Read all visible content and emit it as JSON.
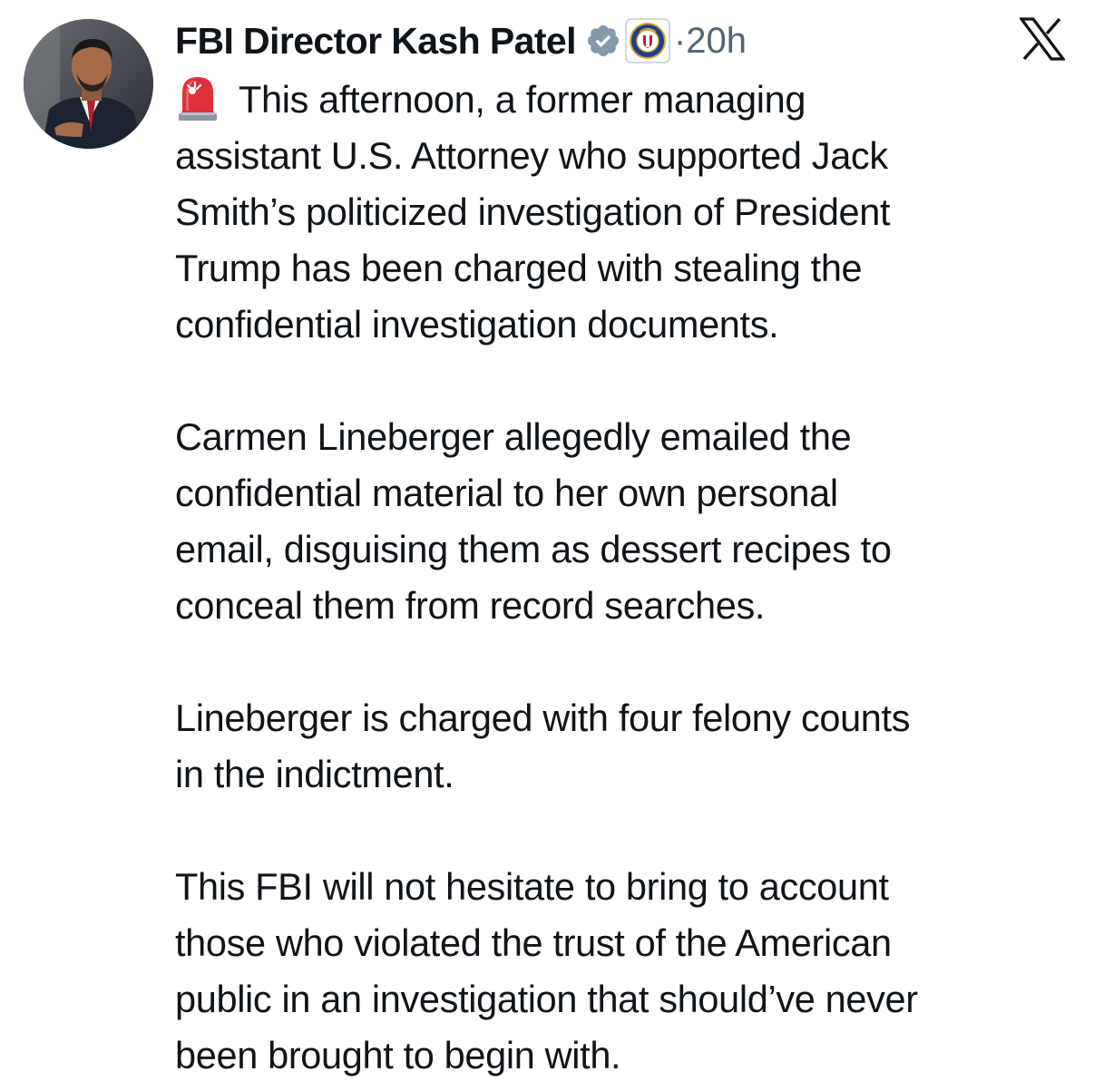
{
  "tweet": {
    "author": {
      "display_name": "FBI Director Kash Patel",
      "verified_icon": "verified-badge-icon",
      "affiliation_icon": "fbi-seal-icon"
    },
    "separator": "·",
    "time": "20h",
    "platform_logo": "x-logo-icon",
    "siren_icon": "rotating-light-emoji",
    "paragraphs": [
      {
        "lines": [
          "This afternoon, a former managing",
          "assistant U.S. Attorney who supported Jack",
          "Smith’s politicized investigation of President",
          "Trump has been charged with stealing the",
          "confidential investigation documents."
        ]
      },
      {
        "lines": [
          "Carmen Lineberger allegedly emailed the",
          "confidential material to her own personal",
          "email, disguising them as dessert recipes to",
          "conceal them from record searches."
        ]
      },
      {
        "lines": [
          "Lineberger is charged with four felony counts",
          "in the indictment."
        ]
      },
      {
        "lines": [
          "This FBI will not hesitate to bring to account",
          "those who violated the trust of the American",
          "public in an investigation that should’ve never",
          "been brought to begin with."
        ]
      }
    ],
    "colors": {
      "text": "#0f1419",
      "secondary": "#536471",
      "verified_badge": "#829aab"
    }
  }
}
